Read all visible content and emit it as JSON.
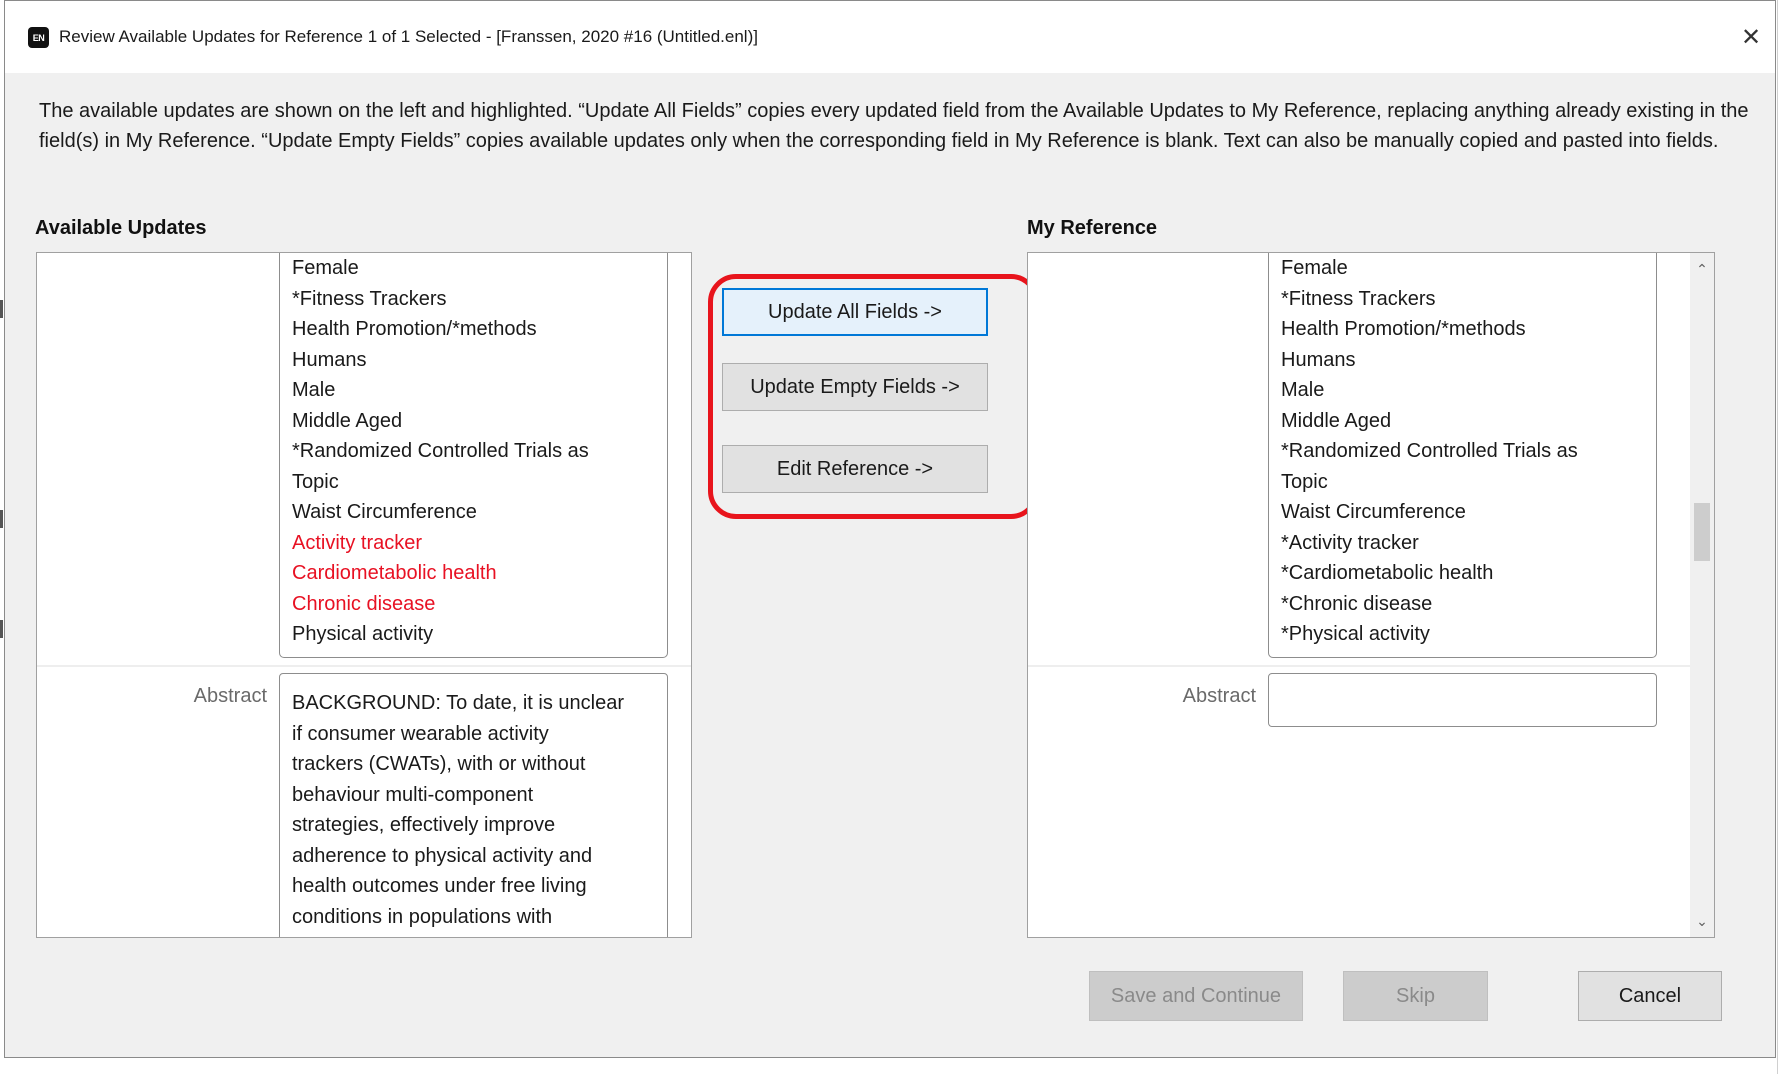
{
  "window": {
    "app_icon_label": "EN",
    "title": "Review Available Updates for Reference 1 of 1 Selected - [Franssen, 2020 #16 (Untitled.enl)]",
    "close_glyph": "✕"
  },
  "instructions": "The available updates are shown on the left and highlighted. “Update All Fields” copies every updated field from the Available Updates to My Reference, replacing anything already existing in the field(s) in My Reference. “Update Empty Fields” copies available updates only when the corresponding field in My Reference is blank. Text can also be manually copied and pasted into fields.",
  "available": {
    "heading": "Available Updates",
    "keywords": [
      {
        "text": "Female",
        "highlighted": false
      },
      {
        "text": "*Fitness Trackers",
        "highlighted": false
      },
      {
        "text": "Health Promotion/*methods",
        "highlighted": false
      },
      {
        "text": "Humans",
        "highlighted": false
      },
      {
        "text": "Male",
        "highlighted": false
      },
      {
        "text": "Middle Aged",
        "highlighted": false
      },
      {
        "text": "*Randomized Controlled Trials as",
        "highlighted": false
      },
      {
        "text": "Topic",
        "highlighted": false
      },
      {
        "text": "Waist Circumference",
        "highlighted": false
      },
      {
        "text": "Activity tracker",
        "highlighted": true
      },
      {
        "text": "Cardiometabolic health",
        "highlighted": true
      },
      {
        "text": "Chronic disease",
        "highlighted": true
      },
      {
        "text": "Physical activity",
        "highlighted": false
      }
    ],
    "abstract_label": "Abstract",
    "abstract_lines": [
      "BACKGROUND: To date, it is unclear",
      "if consumer wearable activity",
      "trackers (CWATs), with or without",
      "behaviour multi-component",
      "strategies, effectively improve",
      "adherence to physical activity and",
      "health outcomes under free living",
      "conditions in populations with"
    ]
  },
  "actions": {
    "update_all": "Update All Fields ->",
    "update_empty": "Update Empty Fields ->",
    "edit_reference": "Edit Reference ->"
  },
  "mine": {
    "heading": "My Reference",
    "keywords": [
      "Female",
      "*Fitness Trackers",
      "Health Promotion/*methods",
      "Humans",
      "Male",
      "Middle Aged",
      "*Randomized Controlled Trials as",
      "Topic",
      "Waist Circumference",
      "*Activity tracker",
      "*Cardiometabolic health",
      "*Chronic disease",
      "*Physical activity"
    ],
    "abstract_label": "Abstract",
    "abstract_value": ""
  },
  "footer": {
    "save_continue": "Save and Continue",
    "skip": "Skip",
    "cancel": "Cancel"
  },
  "background_text": {
    "left": "...",
    "mid": "..."
  },
  "colors": {
    "highlight": "#e81123",
    "annotation_outline": "#e8141c",
    "focus_border": "#0078d7"
  }
}
